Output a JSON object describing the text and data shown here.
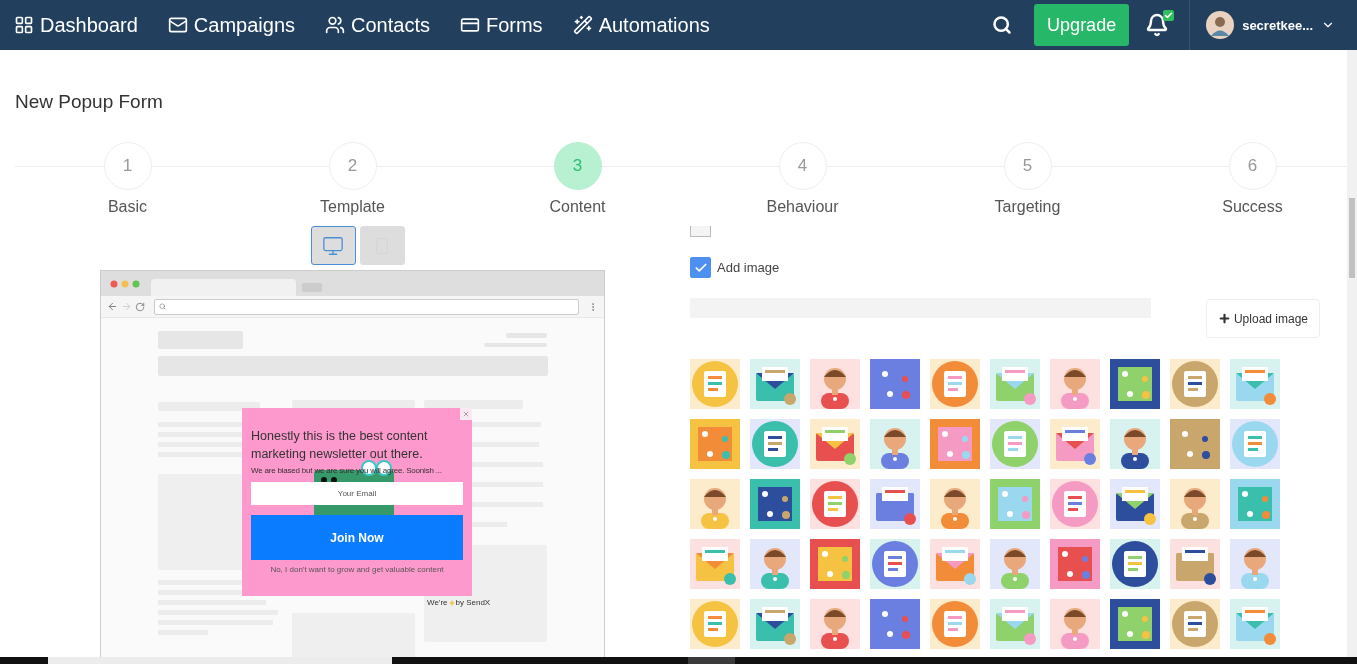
{
  "nav": {
    "items": [
      {
        "label": "Dashboard",
        "kind": "dashboard"
      },
      {
        "label": "Campaigns",
        "kind": "mail"
      },
      {
        "label": "Contacts",
        "kind": "contacts"
      },
      {
        "label": "Forms",
        "kind": "forms"
      },
      {
        "label": "Automations",
        "kind": "wand"
      }
    ],
    "upgrade": "Upgrade",
    "notification": {
      "badge": true
    },
    "user": {
      "name": "secretkee..."
    }
  },
  "page": {
    "title": "New Popup Form"
  },
  "steps": [
    {
      "number": "1",
      "label": "Basic",
      "selected": false
    },
    {
      "number": "2",
      "label": "Template",
      "selected": false
    },
    {
      "number": "3",
      "label": "Content",
      "selected": true
    },
    {
      "number": "4",
      "label": "Behaviour",
      "selected": false
    },
    {
      "number": "5",
      "label": "Targeting",
      "selected": false
    },
    {
      "number": "6",
      "label": "Success",
      "selected": false
    }
  ],
  "preview": {
    "devices": [
      {
        "kind": "desktop",
        "selected": true
      },
      {
        "kind": "mobile",
        "selected": false
      }
    ],
    "popup": {
      "heading": "Honestly this is the best content marketing newsletter out there.",
      "subtext": "We are biased but we are sure you will agree. Soonish ...",
      "email_placeholder": "Your Email",
      "button": "Join Now",
      "decline": "No, I don't want to grow and get valuable content",
      "branding": {
        "before": "We're",
        "after": "by SendX"
      }
    }
  },
  "countdown": {
    "checked": false
  },
  "add_image": {
    "label": "Add image",
    "checked": true
  },
  "upload_button": "Upload image"
}
